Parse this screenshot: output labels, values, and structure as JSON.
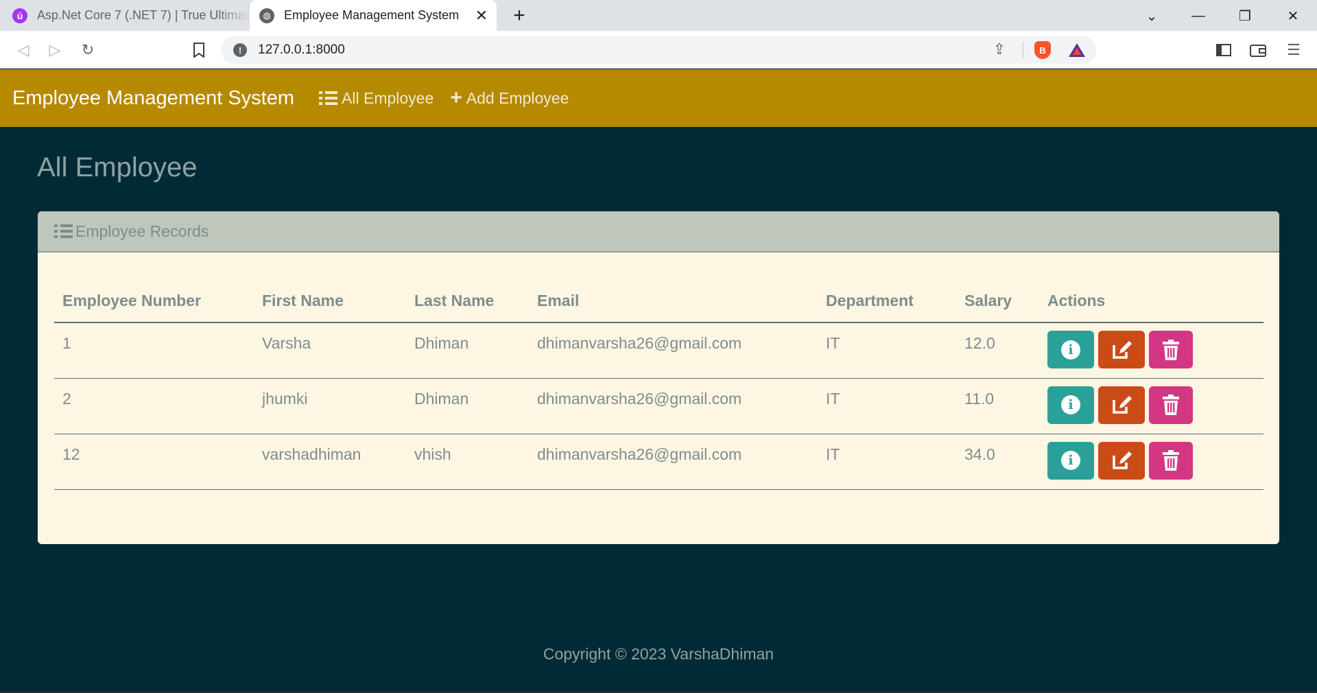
{
  "browser": {
    "tabs": [
      {
        "title": "Asp.Net Core 7 (.NET 7) | True Ultimate",
        "active": false,
        "icon": "udemy-icon"
      },
      {
        "title": "Employee Management System",
        "active": true,
        "icon": "globe-icon"
      }
    ],
    "address": "127.0.0.1:8000"
  },
  "navbar": {
    "brand": "Employee Management System",
    "links": [
      {
        "label": "All Employee",
        "icon": "list-icon"
      },
      {
        "label": "Add Employee",
        "icon": "plus-icon"
      }
    ]
  },
  "main": {
    "page_title": "All Employee",
    "card_title": "Employee Records",
    "columns": [
      "Employee Number",
      "First Name",
      "Last Name",
      "Email",
      "Department",
      "Salary",
      "Actions"
    ],
    "rows": [
      {
        "number": "1",
        "first_name": "Varsha",
        "last_name": "Dhiman",
        "email": "dhimanvarsha26@gmail.com",
        "department": "IT",
        "salary": "12.0"
      },
      {
        "number": "2",
        "first_name": "jhumki",
        "last_name": "Dhiman",
        "email": "dhimanvarsha26@gmail.com",
        "department": "IT",
        "salary": "11.0"
      },
      {
        "number": "12",
        "first_name": "varshadhiman",
        "last_name": "vhish",
        "email": "dhimanvarsha26@gmail.com",
        "department": "IT",
        "salary": "34.0"
      }
    ],
    "actions": [
      "info-icon",
      "edit-icon",
      "delete-icon"
    ]
  },
  "footer": {
    "text": "Copyright © 2023 VarshaDhiman"
  },
  "colors": {
    "navbar": "#b58900",
    "background": "#002b36",
    "card": "#fdf6e3",
    "info_button": "#2aa198",
    "edit_button": "#cb4b16",
    "delete_button": "#d33682"
  }
}
